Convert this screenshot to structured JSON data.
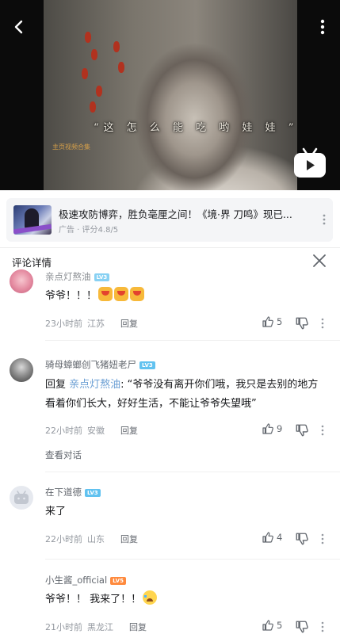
{
  "player": {
    "subtitle": "“这 怎 么 能 吃 哟   娃 娃 ”",
    "watermark_text": "主页视频合集"
  },
  "ad": {
    "title": "极速攻防博弈，胜负毫厘之间！《境·界 刀鸣》现已...",
    "meta": "广告 · 评分4.8/5"
  },
  "panel": {
    "title": "评论详情"
  },
  "comments": [
    {
      "username": "亲点灯熬油",
      "level": "LV3",
      "text": "爷爷！！！",
      "time": "23小时前",
      "location": "江苏",
      "reply_label": "回复",
      "likes": "5"
    },
    {
      "username": "骑母蟑螂创飞猪妞老尸",
      "level": "LV3",
      "reply_prefix": "回复 ",
      "reply_to": "亲点灯熬油",
      "text": ": “爷爷没有离开你们哦，我只是去别的地方看着你们长大，好好生活，不能让爷爷失望哦”",
      "time": "22小时前",
      "location": "安徽",
      "reply_label": "回复",
      "likes": "9",
      "view_conversation": "查看对话"
    },
    {
      "username": "在下道德",
      "level": "LV3",
      "text": "来了",
      "time": "22小时前",
      "location": "山东",
      "reply_label": "回复",
      "likes": "4"
    },
    {
      "username": "小生酱_official",
      "level": "LV5",
      "text": "爷爷！！ 我来了！！",
      "time": "21小时前",
      "location": "黑龙江",
      "reply_label": "回复",
      "likes": "5"
    }
  ]
}
